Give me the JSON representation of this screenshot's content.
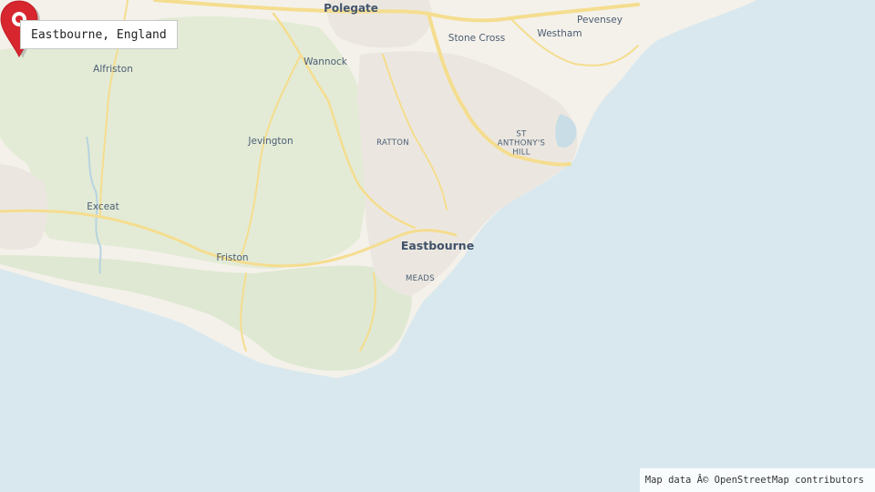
{
  "title": "Eastbourne, England",
  "attribution": "Map data Â© OpenStreetMap contributors",
  "marker": {
    "icon": "map-pin-icon",
    "color": "#d7262e"
  },
  "colors": {
    "sea": "#d8e8ee",
    "land": "#f4f1ea",
    "downs": "#e4ecd7",
    "road": "#f7e5a3",
    "urban": "#ece9e3"
  },
  "places": {
    "polegate": "Polegate",
    "stone_cross": "Stone Cross",
    "westham": "Westham",
    "pevensey": "Pevensey",
    "alfriston": "Alfriston",
    "wannock": "Wannock",
    "jevington": "Jevington",
    "ratton": "RATTON",
    "st_anthonys_hill": "ST\nANTHONY'S\nHILL",
    "exceat": "Exceat",
    "eastbourne": "Eastbourne",
    "friston": "Friston",
    "meads": "MEADS"
  }
}
